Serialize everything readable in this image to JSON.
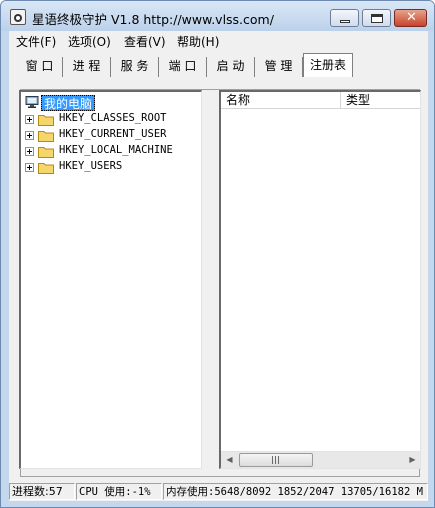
{
  "window": {
    "title": "星语终极守护 V1.8 http://www.vlss.com/",
    "caption_buttons": [
      "minimize",
      "maximize",
      "close"
    ]
  },
  "menu": [
    "文件(F)",
    "选项(O)",
    "查看(V)",
    "帮助(H)"
  ],
  "tabs": [
    {
      "label": "窗 口",
      "active": false
    },
    {
      "label": "进 程",
      "active": false
    },
    {
      "label": "服 务",
      "active": false
    },
    {
      "label": "端 口",
      "active": false
    },
    {
      "label": "启 动",
      "active": false
    },
    {
      "label": "管 理",
      "active": false
    },
    {
      "label": "注册表",
      "active": true
    }
  ],
  "tree": {
    "root": "我的电脑",
    "items": [
      "HKEY_CLASSES_ROOT",
      "HKEY_CURRENT_USER",
      "HKEY_LOCAL_MACHINE",
      "HKEY_USERS"
    ]
  },
  "list": {
    "columns": [
      "名称",
      "类型"
    ]
  },
  "status": {
    "processes": "进程数:57",
    "cpu": "CPU 使用:-1%",
    "memory": "内存使用:5648/8092 1852/2047 13705/16182 M"
  },
  "colors": {
    "selection": "#3399ff",
    "folder": "#f5d66a",
    "close_button": "#c7432c"
  }
}
